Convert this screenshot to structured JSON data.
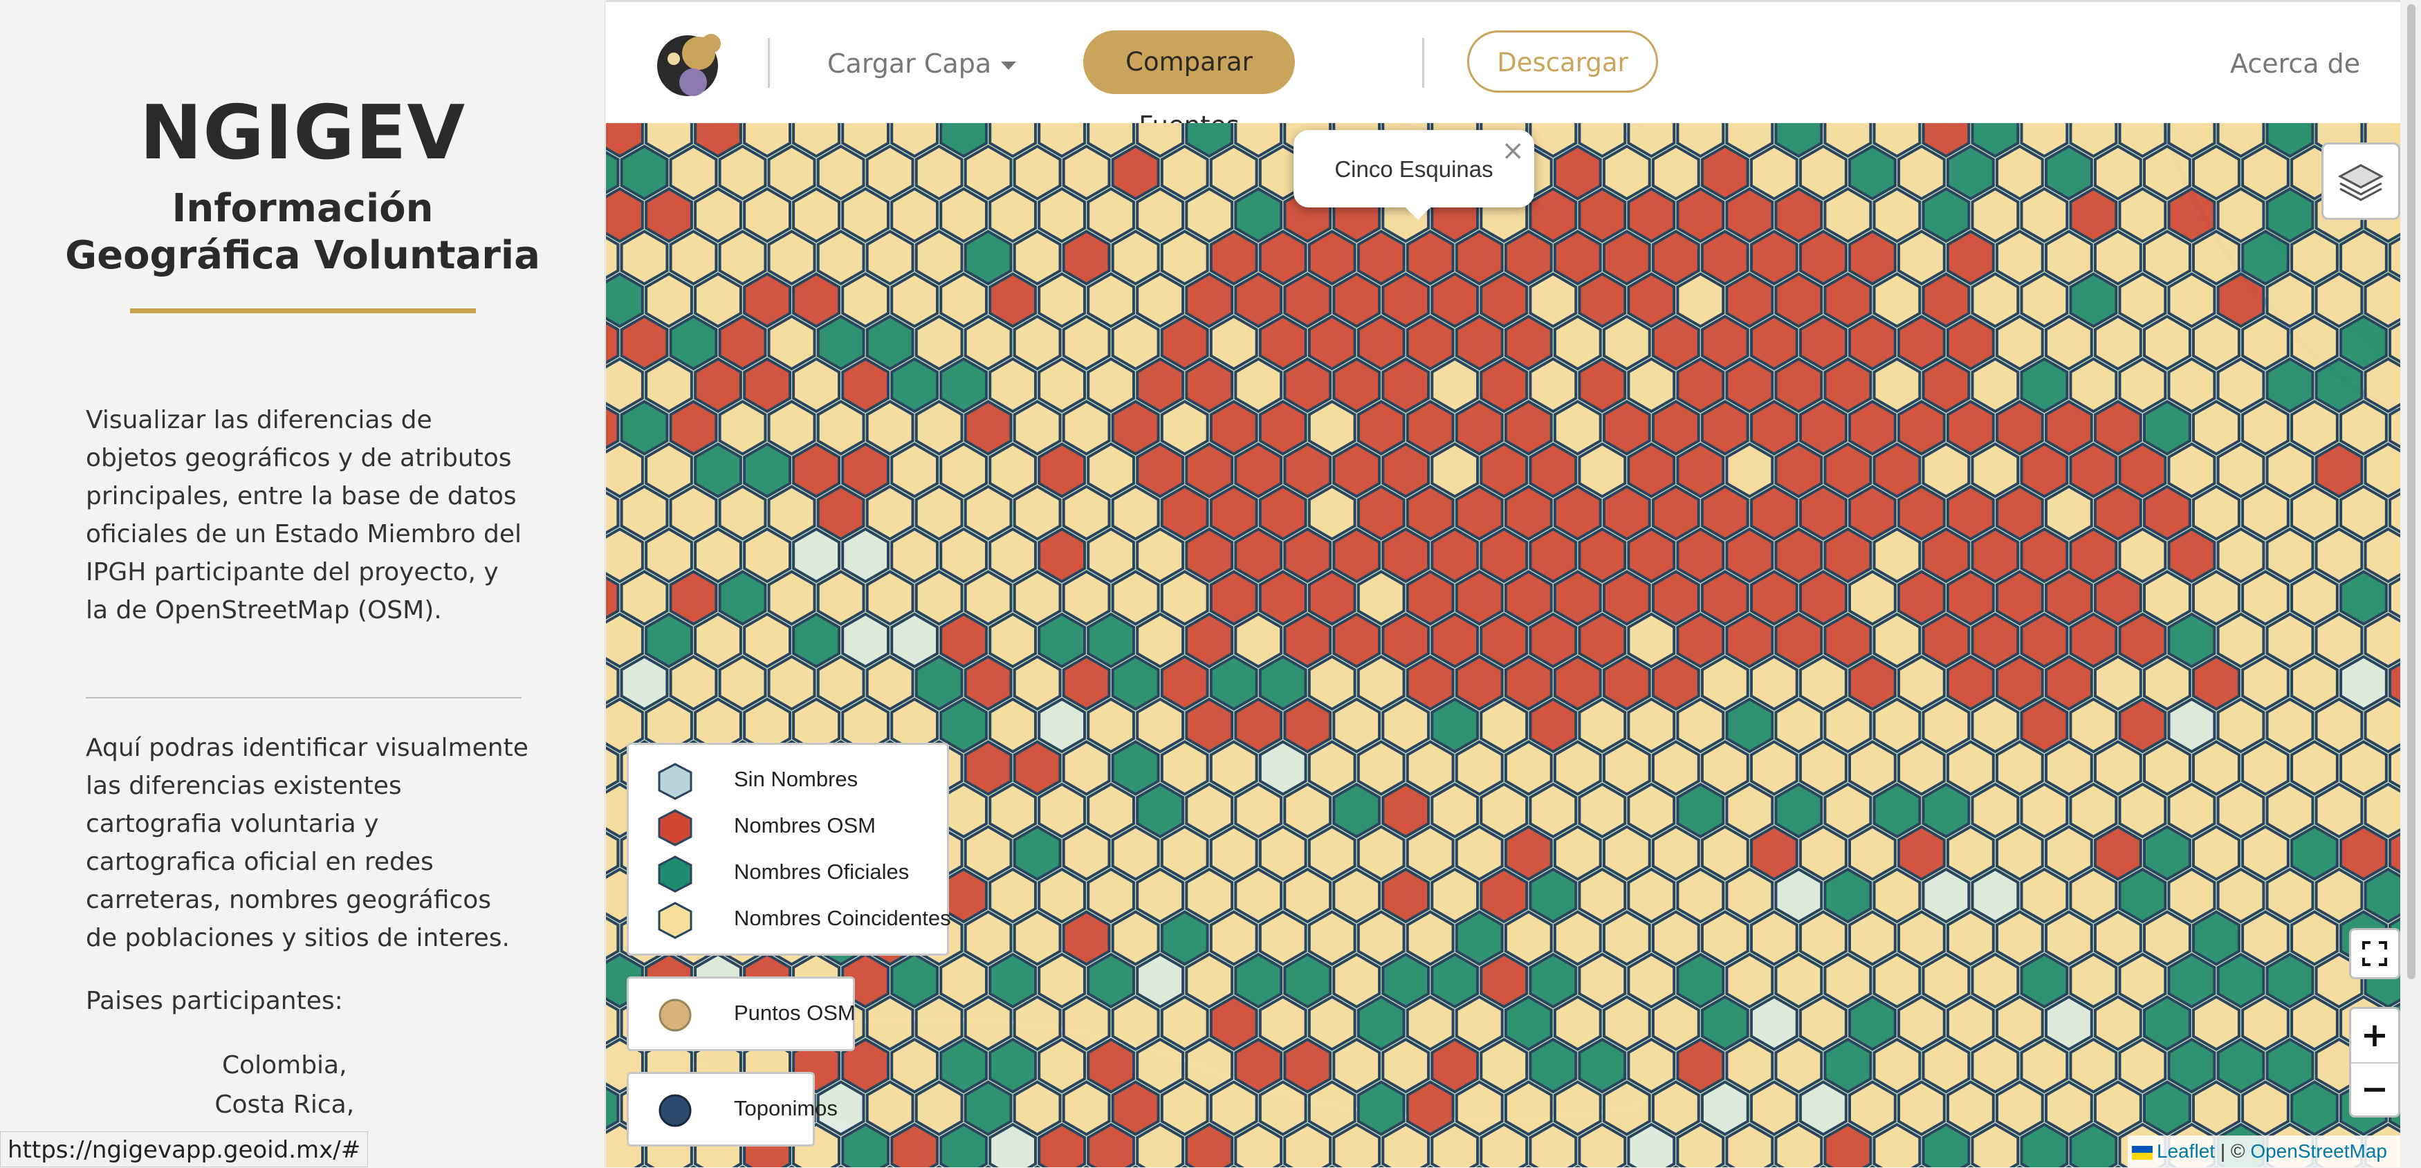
{
  "sidebar": {
    "title": "NGIGEV",
    "subtitle_line1": "Información",
    "subtitle_line2": "Geográfica Voluntaria",
    "paragraph1": "Visualizar las diferencias de objetos geográficos y de atributos principales, entre la base de datos oficiales de un Estado Miembro del IPGH participante del proyecto, y la de OpenStreetMap (OSM).",
    "paragraph2": "Aquí podras identificar visualmente las diferencias existentes cartografia voluntaria y cartografica oficial en redes carreteras, nombres geográficos de poblaciones y sitios de interes.",
    "countries_label": "Paises participantes:",
    "countries": [
      "Colombia,",
      "Costa Rica,"
    ]
  },
  "navbar": {
    "load_layer_label": "Cargar Capa",
    "compare_label": "Comparar Fuentes",
    "download_label": "Descargar",
    "about_label": "Acerca de"
  },
  "map": {
    "popup_text": "Cinco Esquinas",
    "popup_close": "×",
    "zoom_in": "+",
    "zoom_out": "−",
    "legend": [
      {
        "label": "Sin Nombres",
        "color": "#b9d3db"
      },
      {
        "label": "Nombres OSM",
        "color": "#d24634"
      },
      {
        "label": "Nombres Oficiales",
        "color": "#1f8e6c"
      },
      {
        "label": "Nombres Coincidentes",
        "color": "#f9df9c"
      }
    ],
    "points_legend": {
      "label": "Puntos OSM",
      "color": "#d7b27a"
    },
    "toponyms_legend": {
      "label": "Toponimos",
      "color": "#2c4a6e"
    },
    "attribution": {
      "leaflet": "Leaflet",
      "separator": " | © ",
      "osm": "OpenStreetMap"
    },
    "hex_colors": {
      "coincidentes": "#f7dc9c",
      "osm": "#d24a35",
      "oficiales": "#228c69",
      "sin_nombres": "#e9eef0",
      "stroke": "#2a4560"
    }
  },
  "status_bar": {
    "url": "https://ngigevapp.geoid.mx/#"
  }
}
